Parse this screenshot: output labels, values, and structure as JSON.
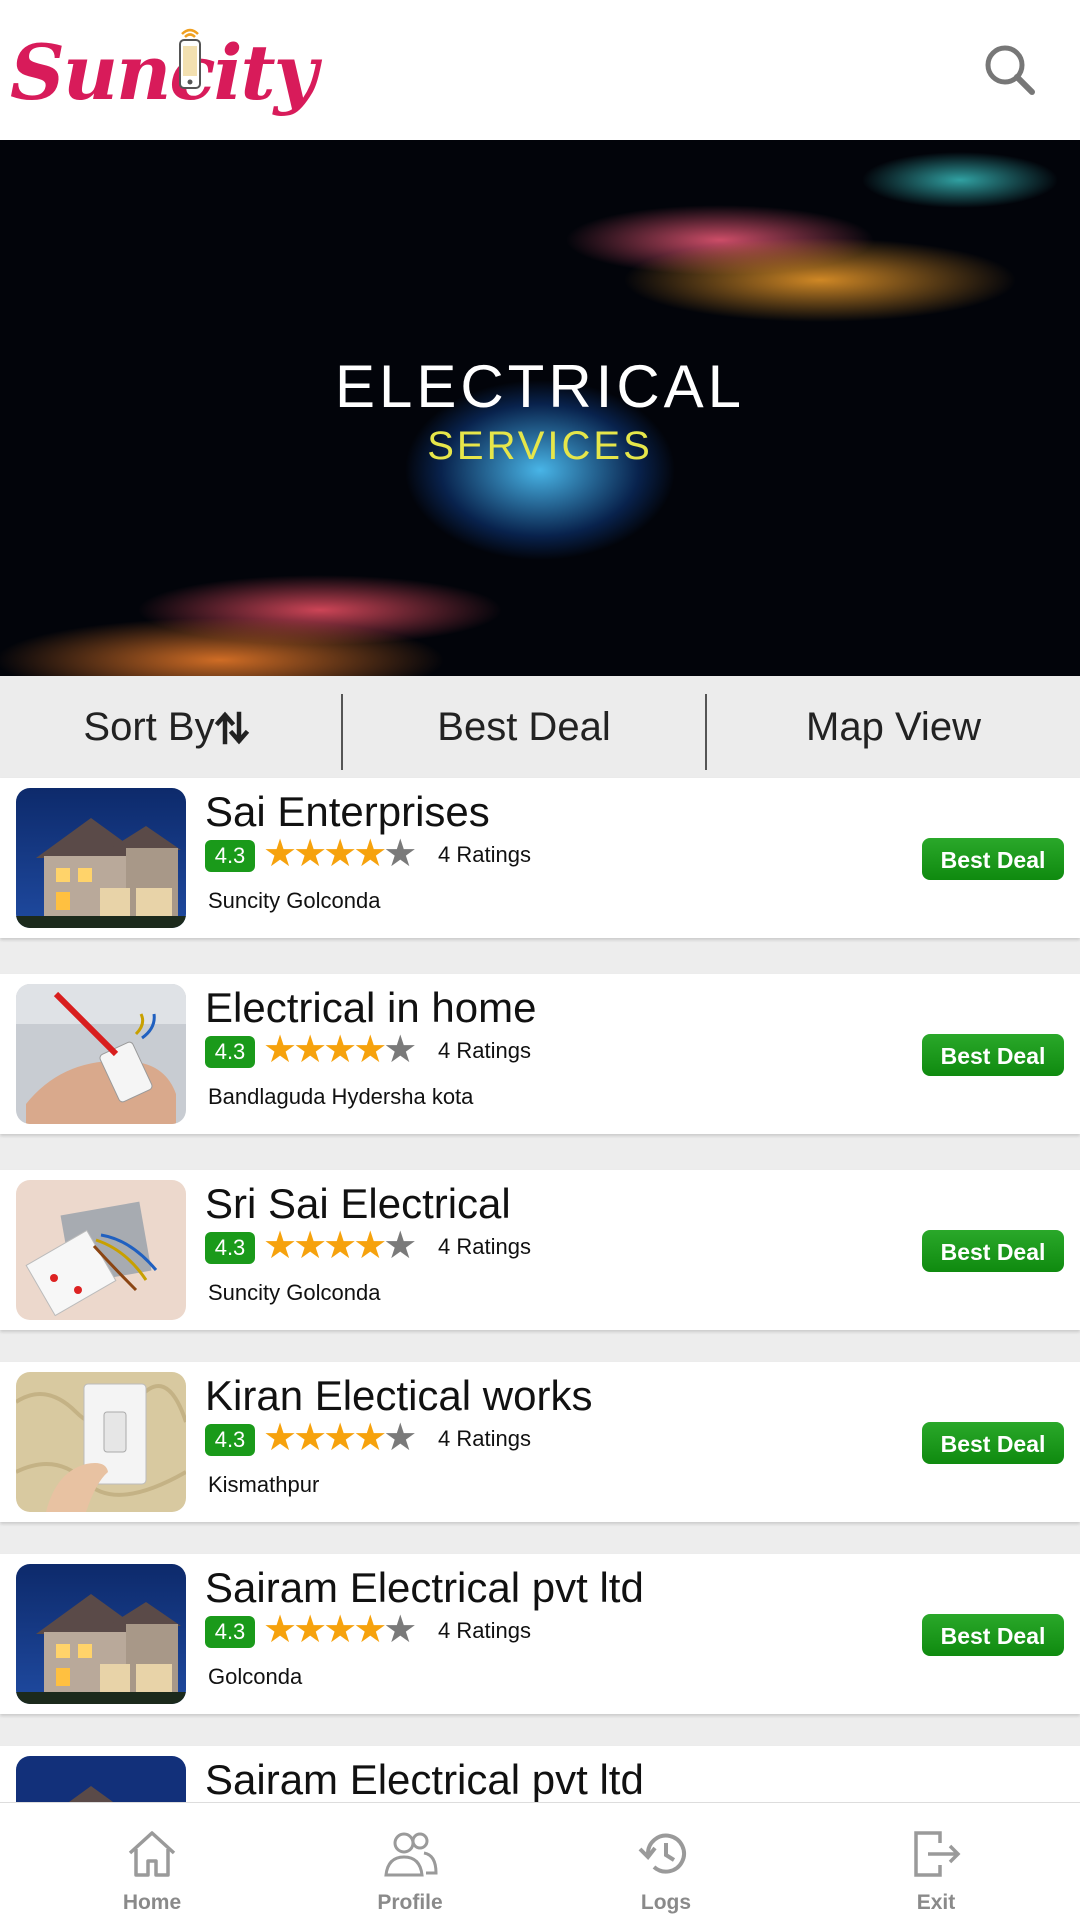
{
  "header": {
    "logo_text": "Suncity",
    "search_icon": "search-icon",
    "brand_color": "#d81b5a"
  },
  "banner": {
    "title": "ELECTRICAL",
    "subtitle": "SERVICES"
  },
  "filters": {
    "sort_label": "Sort By",
    "sort_icon": "sort-arrows-icon",
    "best_deal_label": "Best Deal",
    "map_view_label": "Map View"
  },
  "listings": [
    {
      "name": "Sai Enterprises",
      "rating": "4.3",
      "stars": 4,
      "ratings_text": "4 Ratings",
      "location": "Suncity Golconda",
      "button": "Best Deal",
      "thumb": "house-night-thumbnail"
    },
    {
      "name": "Electrical in home",
      "rating": "4.3",
      "stars": 4,
      "ratings_text": "4 Ratings",
      "location": "Bandlaguda Hydersha kota",
      "button": "Best Deal",
      "thumb": "hand-wiring-thumbnail"
    },
    {
      "name": "Sri Sai Electrical",
      "rating": "4.3",
      "stars": 4,
      "ratings_text": "4 Ratings",
      "location": "Suncity Golconda",
      "button": "Best Deal",
      "thumb": "socket-wiring-thumbnail"
    },
    {
      "name": "Kiran Electical works",
      "rating": "4.3",
      "stars": 4,
      "ratings_text": "4 Ratings",
      "location": "Kismathpur",
      "button": "Best Deal",
      "thumb": "light-switch-thumbnail"
    },
    {
      "name": "Sairam Electrical pvt ltd",
      "rating": "4.3",
      "stars": 4,
      "ratings_text": "4 Ratings",
      "location": "Golconda",
      "button": "Best Deal",
      "thumb": "house-night-thumbnail"
    },
    {
      "name": "Sairam Electrical pvt ltd",
      "thumb": "house-night-thumbnail"
    }
  ],
  "colors": {
    "rating_badge": "#1a9a1a",
    "star": "#f6a20d",
    "deal_button": "#1a9a1a"
  },
  "bottom_nav": [
    {
      "label": "Home",
      "icon": "home-icon"
    },
    {
      "label": "Profile",
      "icon": "profile-icon"
    },
    {
      "label": "Logs",
      "icon": "history-icon"
    },
    {
      "label": "Exit",
      "icon": "exit-icon"
    }
  ]
}
